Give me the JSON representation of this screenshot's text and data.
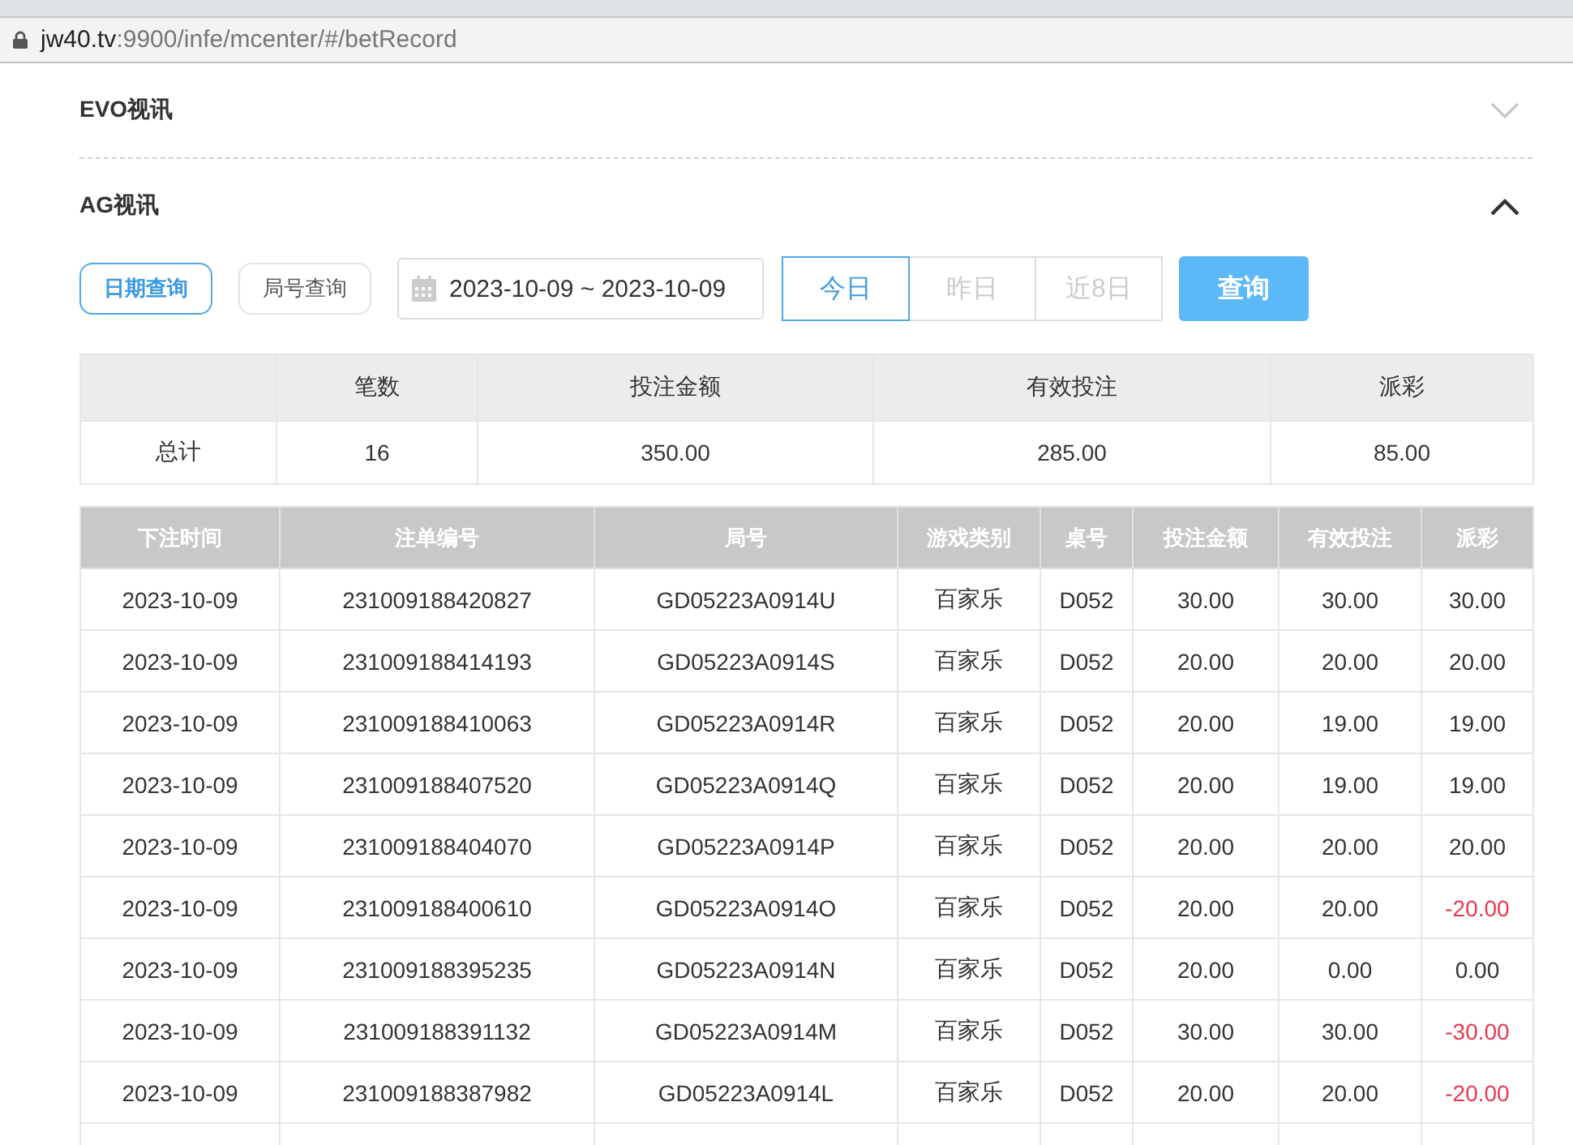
{
  "address_bar": {
    "host": "jw40.tv",
    "path": ":9900/infe/mcenter/#/betRecord"
  },
  "sections": [
    {
      "title": "EVO视讯",
      "expanded": false
    },
    {
      "title": "AG视讯",
      "expanded": true
    }
  ],
  "search_modes": [
    {
      "label": "日期查询",
      "selected": true
    },
    {
      "label": "局号查询",
      "selected": false
    }
  ],
  "date_range": {
    "value": "2023-10-09 ~ 2023-10-09"
  },
  "quick_ranges": [
    {
      "label": "今日",
      "selected": true
    },
    {
      "label": "昨日",
      "selected": false
    },
    {
      "label": "近8日",
      "selected": false
    }
  ],
  "query_button": "查询",
  "summary": {
    "columns": [
      "",
      "笔数",
      "投注金额",
      "有效投注",
      "派彩"
    ],
    "row": [
      "总计",
      "16",
      "350.00",
      "285.00",
      "85.00"
    ]
  },
  "records": {
    "columns": [
      "下注时间",
      "注单编号",
      "局号",
      "游戏类别",
      "桌号",
      "投注金额",
      "有效投注",
      "派彩"
    ],
    "rows": [
      {
        "cells": [
          "2023-10-09",
          "231009188420827",
          "GD05223A0914U",
          "百家乐",
          "D052",
          "30.00",
          "30.00",
          "30.00"
        ],
        "loss": false
      },
      {
        "cells": [
          "2023-10-09",
          "231009188414193",
          "GD05223A0914S",
          "百家乐",
          "D052",
          "20.00",
          "20.00",
          "20.00"
        ],
        "loss": false
      },
      {
        "cells": [
          "2023-10-09",
          "231009188410063",
          "GD05223A0914R",
          "百家乐",
          "D052",
          "20.00",
          "19.00",
          "19.00"
        ],
        "loss": false
      },
      {
        "cells": [
          "2023-10-09",
          "231009188407520",
          "GD05223A0914Q",
          "百家乐",
          "D052",
          "20.00",
          "19.00",
          "19.00"
        ],
        "loss": false
      },
      {
        "cells": [
          "2023-10-09",
          "231009188404070",
          "GD05223A0914P",
          "百家乐",
          "D052",
          "20.00",
          "20.00",
          "20.00"
        ],
        "loss": false
      },
      {
        "cells": [
          "2023-10-09",
          "231009188400610",
          "GD05223A0914O",
          "百家乐",
          "D052",
          "20.00",
          "20.00",
          "-20.00"
        ],
        "loss": true
      },
      {
        "cells": [
          "2023-10-09",
          "231009188395235",
          "GD05223A0914N",
          "百家乐",
          "D052",
          "20.00",
          "0.00",
          "0.00"
        ],
        "loss": false
      },
      {
        "cells": [
          "2023-10-09",
          "231009188391132",
          "GD05223A0914M",
          "百家乐",
          "D052",
          "30.00",
          "30.00",
          "-30.00"
        ],
        "loss": true
      },
      {
        "cells": [
          "2023-10-09",
          "231009188387982",
          "GD05223A0914L",
          "百家乐",
          "D052",
          "20.00",
          "20.00",
          "-20.00"
        ],
        "loss": true
      }
    ]
  }
}
